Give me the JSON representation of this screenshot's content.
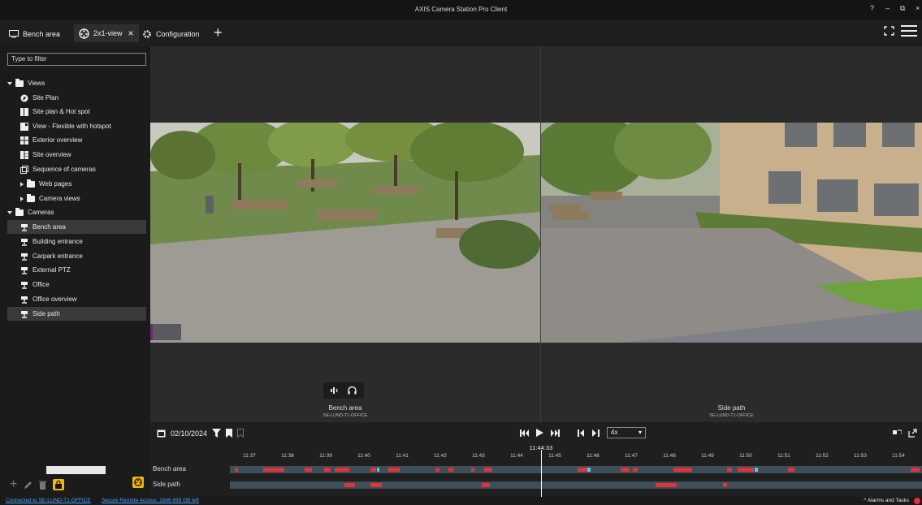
{
  "app": {
    "title": "AXIS Camera Station Pro Client",
    "window_controls": [
      "?",
      "–",
      "⧉",
      "×"
    ]
  },
  "tabs": [
    {
      "label": "Bench area",
      "icon": "monitor-icon"
    },
    {
      "label": "2x1-view",
      "icon": "camera-reel-icon",
      "close": "×"
    },
    {
      "label": "Configuration",
      "icon": "gear-icon"
    }
  ],
  "sidebar": {
    "filter_placeholder": "Type to filter",
    "views_label": "Views",
    "view_items": [
      "Site Plan",
      "Site plan & Hot spot",
      "View - Flexible with hotspot",
      "Exterior overview",
      "Site overview",
      "Sequence of cameras"
    ],
    "web_pages": "Web pages",
    "camera_views": "Camera views",
    "cameras_label": "Cameras",
    "camera_items": [
      "Bench area",
      "Building entrance",
      "Carpark entrance",
      "External PTZ",
      "Office",
      "Office overview",
      "Side path"
    ]
  },
  "tiles": [
    {
      "name": "Bench area",
      "server": "SE-LUND-T1-OFFICE"
    },
    {
      "name": "Side path",
      "server": "SE-LUND-T1-OFFICE"
    }
  ],
  "timeline": {
    "date": "02/10/2024",
    "speed": "4x",
    "current_time": "11:44:33",
    "ticks": [
      "11:37",
      "11:38",
      "11:39",
      "11:40",
      "11:41",
      "11:42",
      "11:43",
      "11:44",
      "11:45",
      "11:46",
      "11:47",
      "11:48",
      "11:49",
      "11:50",
      "11:51",
      "11:52",
      "11:53",
      "11:54"
    ],
    "tracks": [
      {
        "label": "Bench area",
        "events": [
          [
            0.7,
            1.2,
            "r"
          ],
          [
            4.8,
            7.9,
            "r"
          ],
          [
            10.8,
            11.8,
            "r"
          ],
          [
            13.6,
            14.6,
            "r"
          ],
          [
            15.1,
            17.3,
            "r"
          ],
          [
            20.3,
            21.1,
            "r"
          ],
          [
            21.2,
            21.6,
            "c"
          ],
          [
            22.9,
            24.5,
            "r"
          ],
          [
            29.7,
            30.3,
            "r"
          ],
          [
            31.6,
            32.3,
            "r"
          ],
          [
            34.9,
            35.3,
            "r"
          ],
          [
            36.7,
            37.9,
            "r"
          ],
          [
            50.2,
            51.6,
            "r"
          ],
          [
            51.7,
            52.1,
            "c"
          ],
          [
            56.4,
            57.8,
            "r"
          ],
          [
            58.2,
            58.9,
            "r"
          ],
          [
            64.1,
            66.8,
            "r"
          ],
          [
            71.8,
            72.5,
            "r"
          ],
          [
            73.3,
            75.7,
            "r"
          ],
          [
            75.8,
            76.3,
            "c"
          ],
          [
            80.6,
            81.6,
            "r"
          ],
          [
            98.3,
            99.6,
            "r"
          ]
        ]
      },
      {
        "label": "Side path",
        "events": [
          [
            16.5,
            18.1,
            "r"
          ],
          [
            20.3,
            21.9,
            "r"
          ],
          [
            36.4,
            37.6,
            "r"
          ],
          [
            61.5,
            64.6,
            "r"
          ],
          [
            71.2,
            71.8,
            "r"
          ]
        ]
      }
    ]
  },
  "status": {
    "connected": "Connected to SE-LUND-T1-OFFICE",
    "remote": "Secure Remote Access: 1886.699 GB left",
    "alarms": "Alarms and Tasks"
  }
}
